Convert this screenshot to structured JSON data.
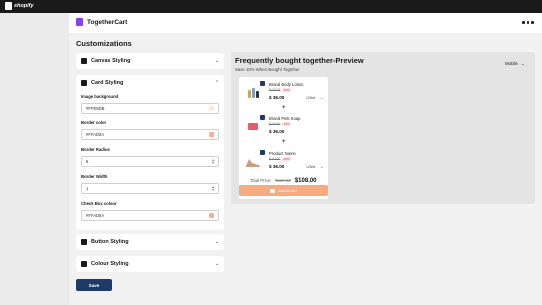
{
  "topbar": {
    "brand": "shopify"
  },
  "app": {
    "name": "TogetherCart"
  },
  "page": {
    "title": "Customizations",
    "save_label": "Save"
  },
  "sections": {
    "canvas": "Canvas Styling",
    "card": "Card Styling",
    "button": "Button Styling",
    "colour": "Colour Styling"
  },
  "fields": {
    "image_background": {
      "label": "Image background",
      "value": "#FFE8DB",
      "swatch": "#FFE8DB"
    },
    "border_color": {
      "label": "Border color",
      "value": "#FFAD8A",
      "swatch": "#FFAD8A"
    },
    "border_radius": {
      "label": "Border Radius",
      "value": "8"
    },
    "border_width": {
      "label": "Border Width",
      "value": "1"
    },
    "checkbox_colour": {
      "label": "Check Box colour",
      "value": "#FFAD8A",
      "swatch": "#FFAD8A"
    }
  },
  "preview": {
    "title": "Frequently bought together-Preview",
    "subtitle": "Save 10% When Bought Together",
    "mode": "Mobile",
    "products": [
      {
        "name": "Brand Body Lotion",
        "old_price": "$ 40.00",
        "tag": "-10%",
        "price": "$ 36.00",
        "size": "125ml"
      },
      {
        "name": "Brand Pink Soap",
        "old_price": "$ 40.00",
        "tag": "-10%",
        "price": "$ 36.00",
        "size": ""
      },
      {
        "name": "Product Name",
        "old_price": "$ 40.00",
        "tag": "-10%",
        "price": "$ 36.00",
        "size": "125ml"
      }
    ],
    "total_label": "Total Price:",
    "total_old": "$120.00",
    "total_new": "$108.00",
    "add_to_cart": "Add to cart"
  }
}
